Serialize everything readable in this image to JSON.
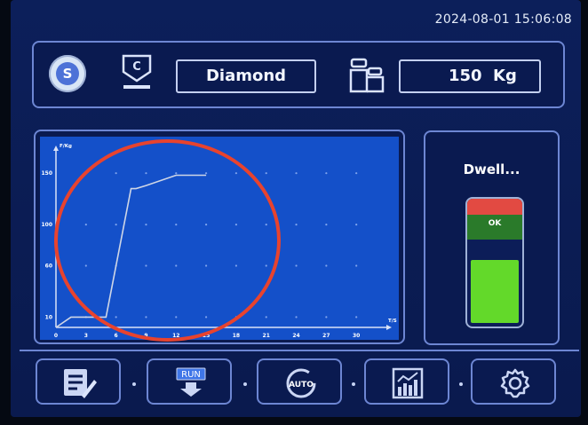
{
  "header": {
    "datetime": "2024-08-01 15:06:08"
  },
  "topbar": {
    "badge_letter": "S",
    "indenter_letter": "C",
    "material": "Diamond",
    "load_value": "150",
    "load_unit": "Kg",
    "icons": [
      "seal-icon",
      "indenter-icon",
      "weights-icon"
    ]
  },
  "chart_data": {
    "type": "line",
    "ylabel": "F/Kg",
    "xlabel": "T/S",
    "x_ticks": [
      "0",
      "3",
      "6",
      "9",
      "12",
      "15",
      "18",
      "21",
      "24",
      "27",
      "30"
    ],
    "y_ticks": [
      "10",
      "60",
      "100",
      "150"
    ],
    "xlim": [
      0,
      33
    ],
    "ylim": [
      0,
      170
    ],
    "grid": true,
    "line_color": "#cfd6e6",
    "series": [
      {
        "x": [
          0,
          1.5,
          3,
          5,
          5.8,
          7.5,
          8,
          9,
          12,
          15
        ],
        "y": [
          0,
          10,
          10,
          10,
          50,
          135,
          135,
          138,
          148,
          148
        ]
      }
    ]
  },
  "status": {
    "text": "Dwell...",
    "gauge_label": "OK",
    "gauge_level_percent": 51,
    "colors": {
      "red": "#e24a42",
      "ok": "#2a7a2a",
      "fill": "#63d92a"
    }
  },
  "toolbar": {
    "buttons": [
      {
        "name": "edit-button",
        "icon": "edit-icon"
      },
      {
        "name": "run-button",
        "icon": "run-icon",
        "label": "RUN"
      },
      {
        "name": "auto-button",
        "icon": "auto-icon",
        "label": "AUTO"
      },
      {
        "name": "chart-button",
        "icon": "chart-icon"
      },
      {
        "name": "settings-button",
        "icon": "gear-icon"
      }
    ]
  }
}
